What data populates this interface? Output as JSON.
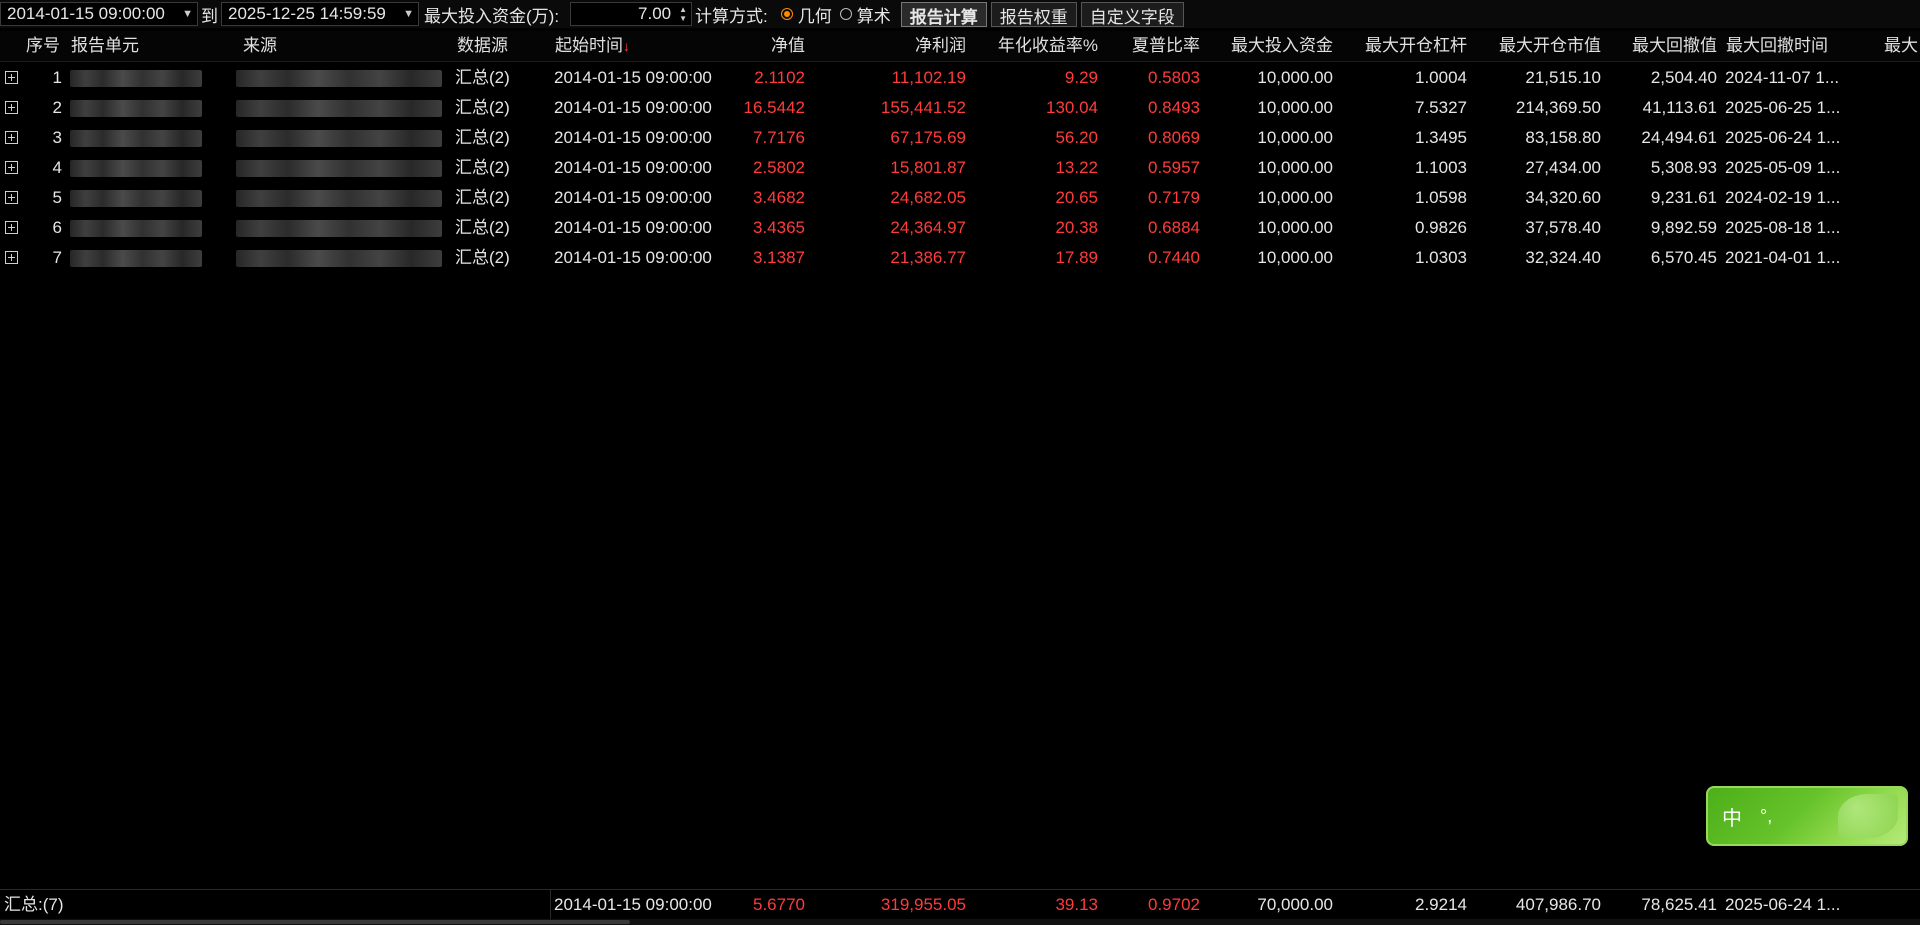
{
  "toolbar": {
    "start_time": "2014-01-15 09:00:00",
    "to_label": "到",
    "end_time": "2025-12-25 14:59:59",
    "capital_label": "最大投入资金(万):",
    "capital_value": "7.00",
    "calc_method_label": "计算方式:",
    "method_geometric": "几何",
    "method_arithmetic": "算术",
    "selected_method": "几何",
    "btn_report_calc": "报告计算",
    "btn_report_weight": "报告权重",
    "btn_custom_field": "自定义字段"
  },
  "table": {
    "columns": {
      "seq": "序号",
      "unit": "报告单元",
      "source": "来源",
      "datasource": "数据源",
      "start": "起始时间",
      "nav": "净值",
      "profit": "净利润",
      "annual": "年化收益率%",
      "sharpe": "夏普比率",
      "maxcap": "最大投入资金",
      "leverage": "最大开仓杠杆",
      "marketval": "最大开仓市值",
      "drawdown": "最大回撤值",
      "ddtime": "最大回撤时间",
      "more": "最大"
    },
    "sort_arrow": "↓",
    "rows": [
      {
        "seq": "1",
        "datasource": "汇总(2)",
        "start": "2014-01-15 09:00:00",
        "nav": "2.1102",
        "profit": "11,102.19",
        "annual": "9.29",
        "sharpe": "0.5803",
        "maxcap": "10,000.00",
        "leverage": "1.0004",
        "marketval": "21,515.10",
        "drawdown": "2,504.40",
        "ddtime": "2024-11-07 1..."
      },
      {
        "seq": "2",
        "datasource": "汇总(2)",
        "start": "2014-01-15 09:00:00",
        "nav": "16.5442",
        "profit": "155,441.52",
        "annual": "130.04",
        "sharpe": "0.8493",
        "maxcap": "10,000.00",
        "leverage": "7.5327",
        "marketval": "214,369.50",
        "drawdown": "41,113.61",
        "ddtime": "2025-06-25 1..."
      },
      {
        "seq": "3",
        "datasource": "汇总(2)",
        "start": "2014-01-15 09:00:00",
        "nav": "7.7176",
        "profit": "67,175.69",
        "annual": "56.20",
        "sharpe": "0.8069",
        "maxcap": "10,000.00",
        "leverage": "1.3495",
        "marketval": "83,158.80",
        "drawdown": "24,494.61",
        "ddtime": "2025-06-24 1..."
      },
      {
        "seq": "4",
        "datasource": "汇总(2)",
        "start": "2014-01-15 09:00:00",
        "nav": "2.5802",
        "profit": "15,801.87",
        "annual": "13.22",
        "sharpe": "0.5957",
        "maxcap": "10,000.00",
        "leverage": "1.1003",
        "marketval": "27,434.00",
        "drawdown": "5,308.93",
        "ddtime": "2025-05-09 1..."
      },
      {
        "seq": "5",
        "datasource": "汇总(2)",
        "start": "2014-01-15 09:00:00",
        "nav": "3.4682",
        "profit": "24,682.05",
        "annual": "20.65",
        "sharpe": "0.7179",
        "maxcap": "10,000.00",
        "leverage": "1.0598",
        "marketval": "34,320.60",
        "drawdown": "9,231.61",
        "ddtime": "2024-02-19 1..."
      },
      {
        "seq": "6",
        "datasource": "汇总(2)",
        "start": "2014-01-15 09:00:00",
        "nav": "3.4365",
        "profit": "24,364.97",
        "annual": "20.38",
        "sharpe": "0.6884",
        "maxcap": "10,000.00",
        "leverage": "0.9826",
        "marketval": "37,578.40",
        "drawdown": "9,892.59",
        "ddtime": "2025-08-18 1..."
      },
      {
        "seq": "7",
        "datasource": "汇总(2)",
        "start": "2014-01-15 09:00:00",
        "nav": "3.1387",
        "profit": "21,386.77",
        "annual": "17.89",
        "sharpe": "0.7440",
        "maxcap": "10,000.00",
        "leverage": "1.0303",
        "marketval": "32,324.40",
        "drawdown": "6,570.45",
        "ddtime": "2021-04-01 1..."
      }
    ]
  },
  "summary": {
    "label": "汇总:(7)",
    "start": "2014-01-15 09:00:00",
    "nav": "5.6770",
    "profit": "319,955.05",
    "annual": "39.13",
    "sharpe": "0.9702",
    "maxcap": "70,000.00",
    "leverage": "2.9214",
    "marketval": "407,986.70",
    "drawdown": "78,625.41",
    "ddtime": "2025-06-24 1..."
  },
  "ime": {
    "mode": "中",
    "punct": "°,"
  },
  "colors": {
    "positive": "#ff3b3b",
    "accent_radio": "#ff8a00",
    "ime_green": "#66c22a"
  }
}
